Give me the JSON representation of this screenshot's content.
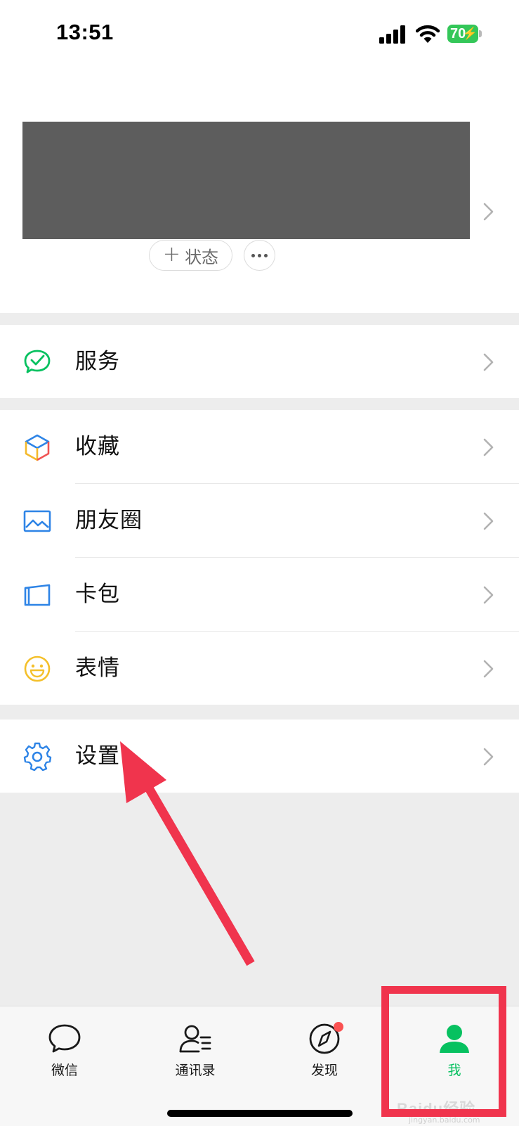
{
  "status_bar": {
    "time": "13:51",
    "battery_level": "70"
  },
  "profile": {
    "status_button_label": "状态",
    "status_button_prefix": "+"
  },
  "menu": {
    "groups": [
      [
        {
          "label": "服务",
          "icon": "wechat-pay-icon",
          "color": "#07c160"
        }
      ],
      [
        {
          "label": "收藏",
          "icon": "cube-icon",
          "color": "#2e84e6"
        },
        {
          "label": "朋友圈",
          "icon": "photo-icon",
          "color": "#2e84e6"
        },
        {
          "label": "卡包",
          "icon": "card-wallet-icon",
          "color": "#2e84e6"
        },
        {
          "label": "表情",
          "icon": "smiley-icon",
          "color": "#f4c02b"
        }
      ],
      [
        {
          "label": "设置",
          "icon": "gear-icon",
          "color": "#2e84e6"
        }
      ]
    ]
  },
  "tab_bar": {
    "tabs": [
      {
        "label": "微信",
        "icon": "chat-bubble-icon"
      },
      {
        "label": "通讯录",
        "icon": "contacts-icon"
      },
      {
        "label": "发现",
        "icon": "compass-icon"
      },
      {
        "label": "我",
        "icon": "person-icon",
        "active": true
      }
    ],
    "accent_color": "#07c160"
  },
  "watermark": {
    "text": "Baidu经验",
    "sub": "jingyan.baidu.com"
  },
  "annotation_color": "#f0344d"
}
